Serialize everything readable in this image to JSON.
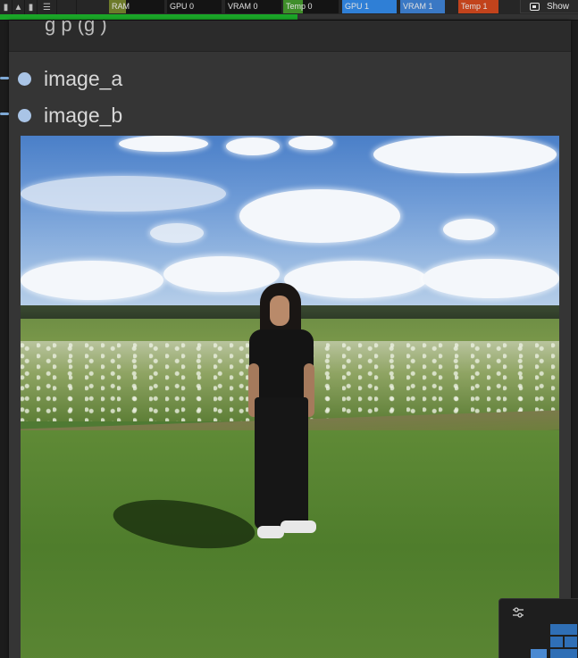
{
  "monitor": {
    "items": [
      {
        "label": "RAM"
      },
      {
        "label": "GPU 0"
      },
      {
        "label": "VRAM 0"
      },
      {
        "label": "Temp 0"
      },
      {
        "label": "GPU 1"
      },
      {
        "label": "VRAM 1"
      },
      {
        "label": "Temp 1"
      }
    ],
    "show_button_label": "Show"
  },
  "progress": {
    "fraction": 0.515
  },
  "node": {
    "title": "g          p      (g         )",
    "inputs": [
      {
        "label": "image_a"
      },
      {
        "label": "image_b"
      }
    ]
  },
  "colors": {
    "progress": "#1aa628",
    "input_dot": "#a9c4e6",
    "gpu1": "#2f7fd6",
    "temp1": "#c2431c"
  },
  "icons": {
    "show": "image-icon",
    "minimap_settings": "sliders-icon"
  }
}
